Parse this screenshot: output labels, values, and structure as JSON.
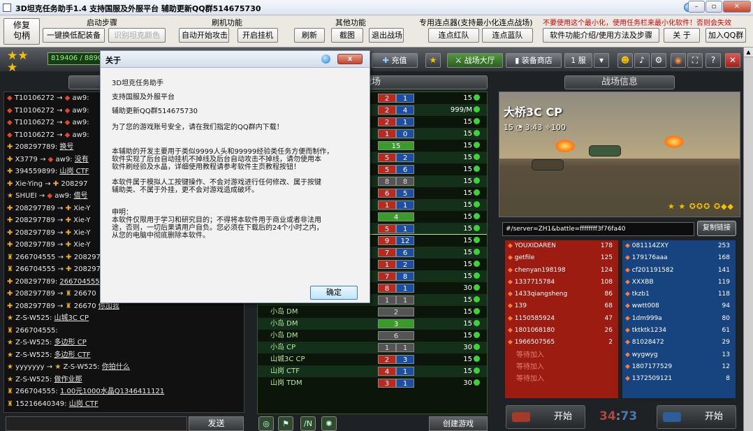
{
  "window": {
    "title": "3D坦克任务助手1.4      支持国服及外服平台   辅助更新QQ群514675730"
  },
  "toolbar": {
    "groups": {
      "start": "启动步骤",
      "brush": "刷机功能",
      "other": "其他功能",
      "connect": "专用连点器(支持最小化连点战场)",
      "warning": "不要使用这个最小化，使用任务栏来最小化软件！否则会失效"
    },
    "buttons": {
      "repair": "修复\n句柄",
      "one_click": "一键换低配装备",
      "recognize": "识别坦克颜色",
      "auto_start": "自动开始攻击",
      "start_hang": "开启挂机",
      "refresh": "刷新",
      "screenshot": "截图",
      "exit_battle": "退出战场",
      "red_team": "连点红队",
      "blue_team": "连点蓝队",
      "intro": "软件功能介绍/使用方法及步骤",
      "about": "关 于",
      "join_qq": "加入QQ群"
    }
  },
  "game": {
    "score": "819406 / 889000",
    "recharge": "充值",
    "battle_hall": "战场大厅",
    "equip_shop": "装备商店",
    "server": "1 服",
    "tabs": {
      "battles": "战场",
      "info": "战场信息"
    },
    "send": "发送",
    "create": "创建游戏",
    "battlefield": {
      "map": "大桥3C CP",
      "players": "15",
      "time": "3:43",
      "score": "100"
    },
    "url": "#/server=ZH1&battle=ffffffff3f76fa40",
    "copy": "复制链接",
    "start": "开始",
    "timer_red": "34",
    "timer_sep": ":",
    "timer_blue": "73"
  },
  "chat": [
    {
      "icon": "◆",
      "u1": "T10106272",
      "arrow": " → ",
      "icon2": "◆",
      "u2": "aw9:",
      "msg": ""
    },
    {
      "icon": "◆",
      "u1": "T10106272",
      "arrow": " → ",
      "icon2": "◆",
      "u2": "aw9:",
      "msg": ""
    },
    {
      "icon": "◆",
      "u1": "T10106272",
      "arrow": " → ",
      "icon2": "◆",
      "u2": "aw9:",
      "msg": ""
    },
    {
      "icon": "◆",
      "u1": "T10106272",
      "arrow": " → ",
      "icon2": "◆",
      "u2": "aw9:",
      "msg": ""
    },
    {
      "icon": "✚",
      "u1": "208297789:",
      "arrow": "",
      "icon2": "",
      "u2": "",
      "msg": "换号"
    },
    {
      "icon": "✚",
      "u1": "X3779",
      "arrow": " → ",
      "icon2": "◆",
      "u2": "aw9:",
      "msg": "没有"
    },
    {
      "icon": "✚",
      "u1": "394559899:",
      "arrow": "",
      "icon2": "",
      "u2": "",
      "msg": "山岗 CTF"
    },
    {
      "icon": "✚",
      "u1": "Xie-Ying",
      "arrow": " → ",
      "icon2": "✚",
      "u2": "208297",
      "msg": ""
    },
    {
      "icon": "★",
      "u1": "SHUEI",
      "arrow": " → ",
      "icon2": "◆",
      "u2": "aw9:",
      "msg": "借号"
    },
    {
      "icon": "✚",
      "u1": "208297789",
      "arrow": " → ",
      "icon2": "✚",
      "u2": "Xie-Y",
      "msg": ""
    },
    {
      "icon": "✚",
      "u1": "208297789",
      "arrow": " → ",
      "icon2": "✚",
      "u2": "Xie-Y",
      "msg": ""
    },
    {
      "icon": "✚",
      "u1": "208297789",
      "arrow": " → ",
      "icon2": "✚",
      "u2": "Xie-Y",
      "msg": ""
    },
    {
      "icon": "✚",
      "u1": "208297789",
      "arrow": " → ",
      "icon2": "✚",
      "u2": "Xie-Y",
      "msg": ""
    },
    {
      "icon": "♜",
      "u1": "266704555",
      "arrow": " → ",
      "icon2": "✚",
      "u2": "208297",
      "msg": ""
    },
    {
      "icon": "♜",
      "u1": "266704555",
      "arrow": " → ",
      "icon2": "✚",
      "u2": "208297",
      "msg": ""
    },
    {
      "icon": "✚",
      "u1": "208297789:",
      "arrow": "",
      "icon2": "",
      "u2": "",
      "msg": "266704555"
    },
    {
      "icon": "✚",
      "u1": "208297789",
      "arrow": " → ",
      "icon2": "♜",
      "u2": "26670",
      "msg": ""
    },
    {
      "icon": "✚",
      "u1": "208297789",
      "arrow": " → ",
      "icon2": "♜",
      "u2": "26670",
      "msg": "你加我"
    },
    {
      "icon": "★",
      "u1": "Z-S-W525:",
      "arrow": "",
      "icon2": "",
      "u2": "",
      "msg": "山城3C CP"
    },
    {
      "icon": "♜",
      "u1": "266704555:",
      "arrow": "",
      "icon2": "",
      "u2": "",
      "msg": ""
    },
    {
      "icon": "★",
      "u1": "Z-S-W525:",
      "arrow": "",
      "icon2": "",
      "u2": "",
      "msg": "多边形 CP"
    },
    {
      "icon": "★",
      "u1": "Z-S-W525:",
      "arrow": "",
      "icon2": "",
      "u2": "",
      "msg": "多边形 CTF"
    },
    {
      "icon": "★",
      "u1": "yyyyyyy",
      "arrow": " → ",
      "icon2": "★",
      "u2": "Z-S-W525:",
      "msg": "你拍什么"
    },
    {
      "icon": "★",
      "u1": "Z-S-W525:",
      "arrow": "",
      "icon2": "",
      "u2": "",
      "msg": "做作业那"
    },
    {
      "icon": "♜",
      "u1": "266704555:",
      "arrow": "",
      "icon2": "",
      "u2": "",
      "msg": "1.00元1000水晶Q1346411121"
    },
    {
      "icon": "♜",
      "u1": "15216640349:",
      "arrow": "",
      "icon2": "",
      "u2": "",
      "msg": "山岗 CTF"
    }
  ],
  "battles": [
    {
      "name": "",
      "a": "2",
      "b": "1",
      "kind": "ab",
      "count": "15"
    },
    {
      "name": "",
      "a": "2",
      "b": "4",
      "kind": "ab",
      "count": "999/M"
    },
    {
      "name": "",
      "a": "2",
      "b": "1",
      "kind": "ab",
      "count": "15"
    },
    {
      "name": "",
      "a": "1",
      "b": "0",
      "kind": "ab",
      "count": "15"
    },
    {
      "name": "",
      "a": "15",
      "b": "",
      "kind": "g",
      "count": "15"
    },
    {
      "name": "",
      "a": "5",
      "b": "2",
      "kind": "ab",
      "count": "15"
    },
    {
      "name": "",
      "a": "5",
      "b": "6",
      "kind": "ab",
      "count": "15"
    },
    {
      "name": "",
      "a": "8",
      "b": "8",
      "kind": "gray",
      "count": "15"
    },
    {
      "name": "",
      "a": "6",
      "b": "5",
      "kind": "ab",
      "count": "15"
    },
    {
      "name": "",
      "a": "1",
      "b": "1",
      "kind": "ab",
      "count": "15"
    },
    {
      "name": "",
      "a": "4",
      "b": "",
      "kind": "g",
      "count": "15"
    },
    {
      "name": "",
      "a": "5",
      "b": "1",
      "kind": "ab",
      "count": "15"
    },
    {
      "name": "",
      "a": "9",
      "b": "12",
      "kind": "ab",
      "count": "15"
    },
    {
      "name": "",
      "a": "7",
      "b": "6",
      "kind": "ab",
      "count": "15"
    },
    {
      "name": "",
      "a": "1",
      "b": "2",
      "kind": "ab",
      "count": "15"
    },
    {
      "name": "",
      "a": "7",
      "b": "8",
      "kind": "ab",
      "count": "15"
    },
    {
      "name": "",
      "a": "8",
      "b": "1",
      "kind": "ab",
      "count": "30"
    },
    {
      "name": "小岛 CTF",
      "a": "1",
      "b": "1",
      "kind": "gray",
      "count": "15"
    },
    {
      "name": "小岛 DM",
      "a": "2",
      "b": "",
      "kind": "grayg",
      "count": "15"
    },
    {
      "name": "小岛 DM",
      "a": "3",
      "b": "",
      "kind": "g",
      "count": "15"
    },
    {
      "name": "小岛 DM",
      "a": "6",
      "b": "",
      "kind": "grayg",
      "count": "15"
    },
    {
      "name": "小岛 CP",
      "a": "1",
      "b": "1",
      "kind": "gray",
      "count": "30"
    },
    {
      "name": "山城3C CP",
      "a": "2",
      "b": "3",
      "kind": "ab",
      "count": "15"
    },
    {
      "name": "山岗 CTF",
      "a": "4",
      "b": "1",
      "kind": "ab",
      "count": "15"
    },
    {
      "name": "山岗 TDM",
      "a": "3",
      "b": "1",
      "kind": "ab",
      "count": "30"
    }
  ],
  "red_team": [
    {
      "name": "YOUXIDAREN",
      "score": "178"
    },
    {
      "name": "getfile",
      "score": "125"
    },
    {
      "name": "chenyan198198",
      "score": "124"
    },
    {
      "name": "1337715784",
      "score": "108"
    },
    {
      "name": "1433qiangsheng",
      "score": "86"
    },
    {
      "name": "139",
      "score": "68"
    },
    {
      "name": "1150585924",
      "score": "47"
    },
    {
      "name": "1801068180",
      "score": "26"
    },
    {
      "name": "1966507565",
      "score": "2"
    },
    {
      "name": "等待加入",
      "score": ""
    },
    {
      "name": "等待加入",
      "score": ""
    },
    {
      "name": "等待加入",
      "score": ""
    }
  ],
  "blue_team": [
    {
      "name": "081114ZXY",
      "score": "253"
    },
    {
      "name": "179176aaa",
      "score": "168"
    },
    {
      "name": "cf201191582",
      "score": "141"
    },
    {
      "name": "XXXBB",
      "score": "119"
    },
    {
      "name": "tkzb1",
      "score": "118"
    },
    {
      "name": "wwtt008",
      "score": "94"
    },
    {
      "name": "1dm999a",
      "score": "80"
    },
    {
      "name": "tktktk1234",
      "score": "61"
    },
    {
      "name": "81028472",
      "score": "29"
    },
    {
      "name": "wygwyg",
      "score": "13"
    },
    {
      "name": "1807177529",
      "score": "12"
    },
    {
      "name": "1372509121",
      "score": "8"
    }
  ],
  "dialog": {
    "title": "关于",
    "close": "x",
    "ok": "确定",
    "lines": [
      "3D坦克任务助手",
      "支持国服及外服平台",
      "辅助更新QQ群514675730",
      "为了您的游戏账号安全，请在我们指定的QQ群内下载！",
      "本辅助的开发主要用于类似9999人头和99999经验类任务方便而制作，",
      "软件实现了后台自动挂机不掉线及后台自动攻击不掉线，请勿使用本",
      "软件刷经验及水晶，详细使用教程请参考软件主页教程按钮！",
      "本软件属于模拟人工按键操作、不会对游戏进行任何修改、属于按键",
      "辅助类、不属于外挂，更不会对游戏造成破坏。",
      "申明：",
      "本软件仅限用于学习和研究目的；不得将本软件用于商业或者非法用",
      "途，否则，一切后果请用户自负。您必须在下载后的24个小时之内，",
      "从您的电脑中彻底删除本软件。"
    ]
  }
}
